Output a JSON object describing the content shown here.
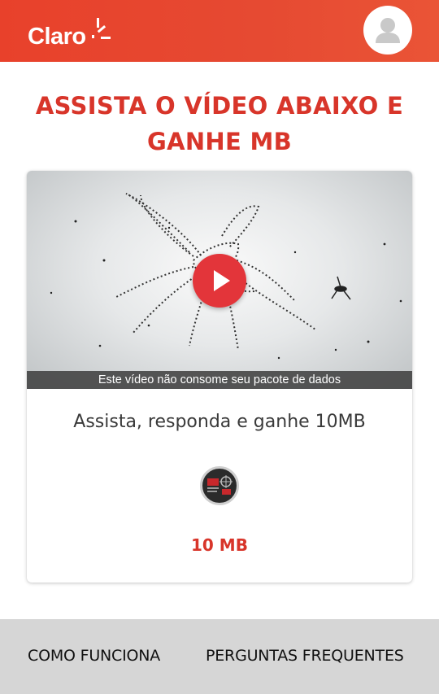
{
  "header": {
    "logo_text": "Claro",
    "logo_icon": "claro-sun-rays-icon",
    "profile_icon": "user-avatar-icon",
    "brand_color": "#e8412b"
  },
  "main": {
    "title_line1": "ASSISTA O VÍDEO ABAIXO E",
    "title_line2": "GANHE MB",
    "title_color": "#d8352a"
  },
  "video": {
    "caption": "Este vídeo não consome seu pacote de dados",
    "play_icon": "play-icon",
    "play_color": "#e3353a"
  },
  "offer": {
    "text": "Assista, responda e ganhe 10MB",
    "badge_icon": "campaign-badge-icon",
    "amount": "10 MB"
  },
  "footer": {
    "links": [
      "COMO FUNCIONA",
      "PERGUNTAS FREQUENTES"
    ],
    "background": "#d6d6d6"
  }
}
